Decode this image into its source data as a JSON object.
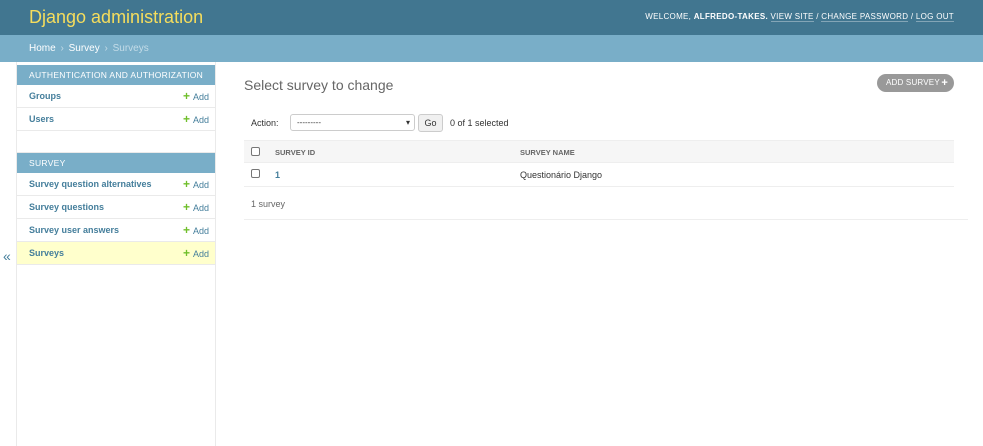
{
  "header": {
    "branding": "Django administration",
    "welcome": "WELCOME,",
    "username": "ALFREDO-TAKES.",
    "view_site": "VIEW SITE",
    "sep": " / ",
    "change_password": "CHANGE PASSWORD",
    "logout": "LOG OUT"
  },
  "breadcrumbs": {
    "home": "Home",
    "app": "Survey",
    "current": "Surveys",
    "separator": "›"
  },
  "sidebar": {
    "toggle": "«",
    "modules": [
      {
        "caption": "Authentication and Authorization",
        "rows": [
          {
            "label": "Groups",
            "add": "Add"
          },
          {
            "label": "Users",
            "add": "Add"
          }
        ]
      },
      {
        "caption": "Survey",
        "rows": [
          {
            "label": "Survey question alternatives",
            "add": "Add"
          },
          {
            "label": "Survey questions",
            "add": "Add"
          },
          {
            "label": "Survey user answers",
            "add": "Add"
          },
          {
            "label": "Surveys",
            "add": "Add"
          }
        ]
      }
    ]
  },
  "content": {
    "title": "Select survey to change",
    "add_button": "ADD SURVEY",
    "actions": {
      "label": "Action:",
      "selected_option": "---------",
      "go": "Go",
      "selected_count": "0 of 1 selected"
    },
    "table": {
      "headers": [
        "SURVEY ID",
        "SURVEY NAME"
      ],
      "rows": [
        {
          "id": "1",
          "name": "Questionário Django"
        }
      ]
    },
    "paginator": "1 survey"
  },
  "colors": {
    "header_bg": "#417690",
    "branding": "#f5dd5d",
    "breadcrumbs_bg": "#79aec8",
    "link": "#447e9b",
    "add_green": "#70bf2b",
    "current_row": "#ffffcc"
  },
  "icons": {
    "add": "plus-icon",
    "select": "chevron-down-icon",
    "collapse": "double-chevron-left-icon"
  }
}
